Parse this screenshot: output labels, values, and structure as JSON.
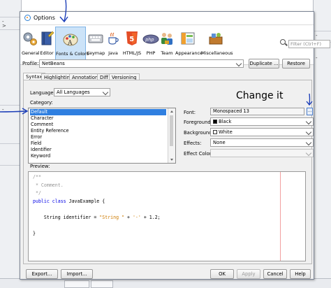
{
  "window": {
    "title": "Options"
  },
  "backdrop": {
    "left_lines": [
      "-",
      ">",
      "-"
    ],
    "right_lines": [
      "-",
      "B",
      "-"
    ]
  },
  "categories": [
    {
      "label": "General",
      "icon": "general-gears-icon",
      "selected": false
    },
    {
      "label": "Editor",
      "icon": "editor-book-icon",
      "selected": false
    },
    {
      "label": "Fonts & Colors",
      "icon": "fonts-colors-palette-icon",
      "selected": true
    },
    {
      "label": "Keymap",
      "icon": "keymap-keyboard-icon",
      "selected": false
    },
    {
      "label": "Java",
      "icon": "java-cup-icon",
      "selected": false
    },
    {
      "label": "HTML/JS",
      "icon": "html5-icon",
      "selected": false
    },
    {
      "label": "PHP",
      "icon": "php-icon",
      "selected": false
    },
    {
      "label": "Team",
      "icon": "team-people-icon",
      "selected": false
    },
    {
      "label": "Appearance",
      "icon": "appearance-window-icon",
      "selected": false
    },
    {
      "label": "Miscellaneous",
      "icon": "miscellaneous-icon",
      "selected": false
    }
  ],
  "search": {
    "placeholder": "Filter (Ctrl+F)"
  },
  "profile": {
    "label": "Profile:",
    "value": "NetBeans",
    "duplicate_label": "Duplicate ...",
    "restore_label": "Restore"
  },
  "tabs": [
    {
      "label": "Syntax",
      "selected": true
    },
    {
      "label": "Highlighting",
      "selected": false
    },
    {
      "label": "Annotations",
      "selected": false
    },
    {
      "label": "Diff",
      "selected": false
    },
    {
      "label": "Versioning",
      "selected": false
    }
  ],
  "language": {
    "label": "Language:",
    "value": "All Languages"
  },
  "category": {
    "label": "Category:",
    "items": [
      "Default",
      "Character",
      "Comment",
      "Entity Reference",
      "Error",
      "Field",
      "Identifier",
      "Keyword"
    ],
    "selected": "Default"
  },
  "properties": {
    "font": {
      "label": "Font:",
      "value": "Monospaced 13",
      "button": "..."
    },
    "foreground": {
      "label": "Foreground:",
      "value": "Black",
      "swatch": "#000000"
    },
    "background": {
      "label": "Background:",
      "value": "White",
      "swatch": "#ffffff"
    },
    "effects": {
      "label": "Effects:",
      "value": "None"
    },
    "effect_color": {
      "label": "Effect Color:",
      "value": ""
    }
  },
  "preview": {
    "label": "Preview:",
    "lines": [
      {
        "parts": [
          {
            "t": "/**",
            "c": "comment"
          }
        ]
      },
      {
        "parts": [
          {
            "t": " * Comment.",
            "c": "comment"
          }
        ]
      },
      {
        "parts": [
          {
            "t": " */",
            "c": "comment"
          }
        ]
      },
      {
        "parts": [
          {
            "t": "public class",
            "c": "kw"
          },
          {
            "t": " JavaExample {",
            "c": "plain"
          }
        ]
      },
      {
        "parts": [
          {
            "t": "",
            "c": "plain"
          }
        ]
      },
      {
        "parts": [
          {
            "t": "    String identifier = ",
            "c": "plain"
          },
          {
            "t": "\"String \"",
            "c": "str"
          },
          {
            "t": " + ",
            "c": "plain"
          },
          {
            "t": "'-'",
            "c": "str"
          },
          {
            "t": " + 1.2;",
            "c": "plain"
          }
        ]
      },
      {
        "parts": [
          {
            "t": "",
            "c": "plain"
          }
        ]
      },
      {
        "parts": [
          {
            "t": "}",
            "c": "plain"
          }
        ]
      }
    ]
  },
  "footer": {
    "export": "Export...",
    "import": "Import...",
    "ok": "OK",
    "apply": "Apply",
    "cancel": "Cancel",
    "help": "Help"
  },
  "annotation": {
    "text": "Change it",
    "color": "#1d3fb8"
  }
}
